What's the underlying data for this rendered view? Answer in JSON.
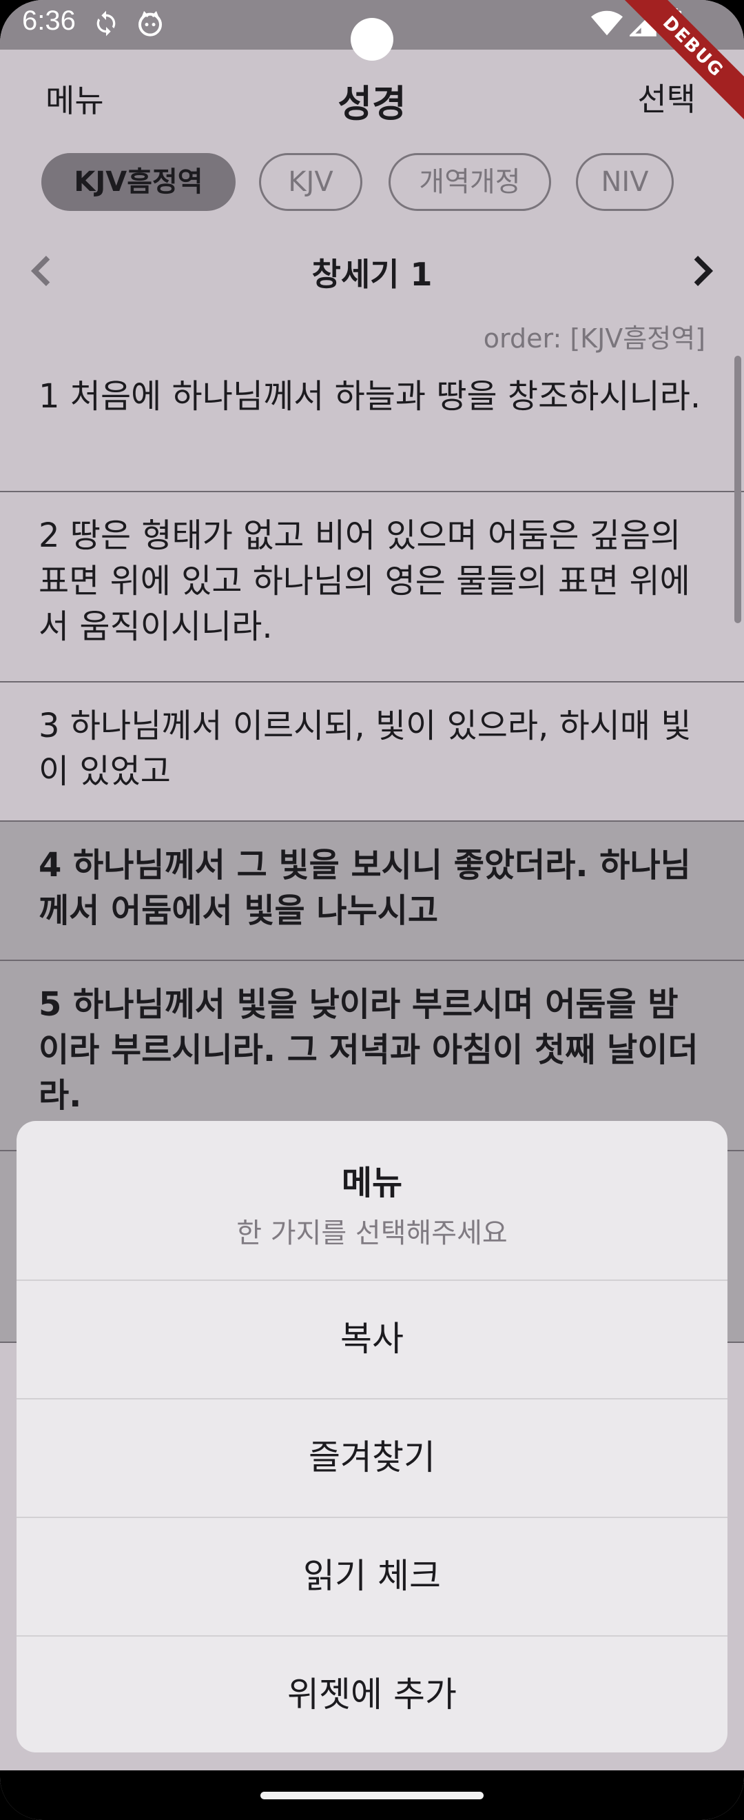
{
  "status_bar": {
    "time": "6:36",
    "debug_label": "DEBUG"
  },
  "app_bar": {
    "menu_label": "메뉴",
    "title": "성경",
    "select_label": "선택"
  },
  "translations": [
    {
      "label": "KJV흠정역",
      "selected": true
    },
    {
      "label": "KJV",
      "selected": false
    },
    {
      "label": "개역개정",
      "selected": false
    },
    {
      "label": "NIV",
      "selected": false
    }
  ],
  "chapter": {
    "title": "창세기 1",
    "order_label": "order: [KJV흠정역]"
  },
  "verses": [
    {
      "text": "1  처음에 하나님께서 하늘과 땅을 창조하시니라.",
      "selected": false
    },
    {
      "text": "2  땅은 형태가 없고 비어 있으며 어둠은 깊음의 표면 위에 있고 하나님의 영은 물들의 표면 위에서 움직이시니라.",
      "selected": false
    },
    {
      "text": "3  하나님께서 이르시되, 빛이 있으라, 하시매 빛이 있었고",
      "selected": false
    },
    {
      "text": "4  하나님께서 그 빛을 보시니 좋았더라. 하나님께서 어둠에서 빛을 나누시고",
      "selected": true
    },
    {
      "text": "5  하나님께서 빛을 낮이라 부르시며 어둠을 밤이라 부르시니라. 그 저녁과 아침이 첫째 날이더라.",
      "selected": true
    }
  ],
  "menu_sheet": {
    "title": "메뉴",
    "subtitle": "한 가지를 선택해주세요",
    "items": [
      "복사",
      "즐겨찾기",
      "읽기 체크",
      "위젯에 추가"
    ]
  },
  "colors": {
    "background": "#cbc4cb",
    "selected_row": "#a8a4a9",
    "chip_selected": "#7a757c",
    "debug_banner": "#a32121"
  }
}
